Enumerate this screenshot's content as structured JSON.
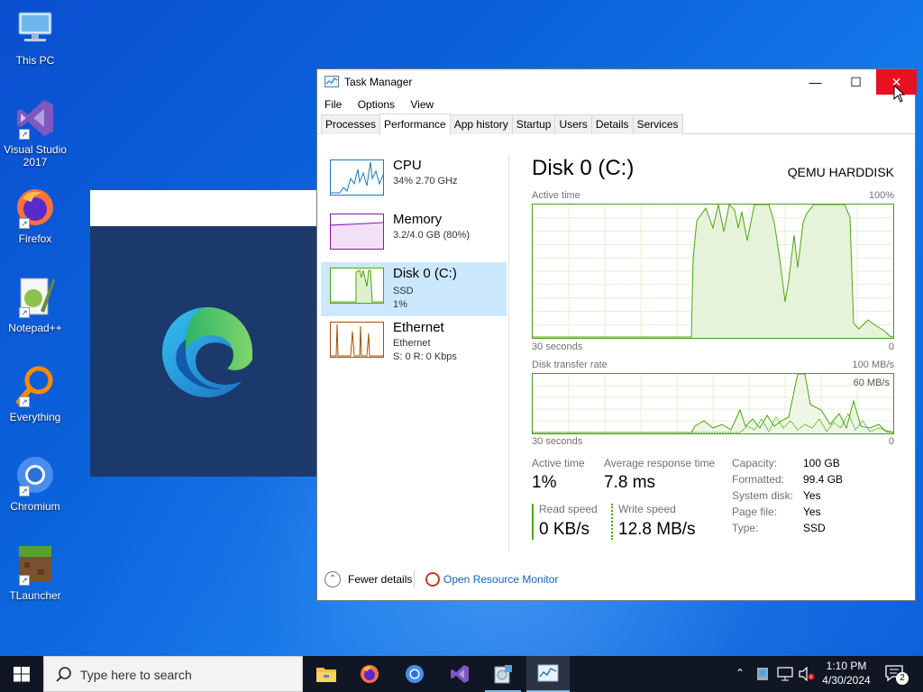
{
  "desktop": {
    "icons": [
      {
        "label": "This PC",
        "icon": "this-pc-icon"
      },
      {
        "label": "Visual Studio 2017",
        "icon": "visual-studio-icon"
      },
      {
        "label": "Firefox",
        "icon": "firefox-icon"
      },
      {
        "label": "Notepad++",
        "icon": "notepadpp-icon"
      },
      {
        "label": "Everything",
        "icon": "everything-icon"
      },
      {
        "label": "Chromium",
        "icon": "chromium-icon"
      },
      {
        "label": "TLauncher",
        "icon": "tlauncher-icon"
      }
    ]
  },
  "task_manager": {
    "title": "Task Manager",
    "menu": [
      "File",
      "Options",
      "View"
    ],
    "tabs": [
      "Processes",
      "Performance",
      "App history",
      "Startup",
      "Users",
      "Details",
      "Services"
    ],
    "active_tab": "Performance",
    "sidebar": [
      {
        "name": "CPU",
        "line1": "34%  2.70 GHz",
        "line2": "",
        "color": "#117dbb"
      },
      {
        "name": "Memory",
        "line1": "3.2/4.0 GB (80%)",
        "line2": "",
        "color": "#8b12ae"
      },
      {
        "name": "Disk 0 (C:)",
        "line1": "SSD",
        "line2": "1%",
        "color": "#4da60c"
      },
      {
        "name": "Ethernet",
        "line1": "Ethernet",
        "line2": "S: 0  R: 0 Kbps",
        "color": "#a74f01"
      }
    ],
    "selected": "Disk 0 (C:)",
    "detail": {
      "title": "Disk 0 (C:)",
      "model": "QEMU HARDDISK",
      "graph1": {
        "label": "Active time",
        "max": "100%",
        "time": "30 seconds",
        "min": "0",
        "values": [
          0,
          0,
          0,
          0,
          0,
          0,
          0,
          0,
          0,
          0,
          0,
          0,
          0,
          0,
          0,
          0,
          0,
          0,
          0,
          0,
          0,
          0,
          0,
          0,
          0,
          0,
          0,
          0,
          0,
          0,
          0,
          0,
          0,
          0,
          0,
          0,
          0,
          0,
          0,
          0,
          0,
          0,
          0,
          0,
          0,
          0,
          0,
          0,
          0,
          0,
          0,
          0,
          0,
          0,
          0,
          0,
          0,
          0,
          0,
          0,
          0,
          0,
          0,
          0,
          0,
          0,
          0,
          0,
          0,
          0,
          0,
          0,
          0,
          0,
          0,
          0,
          0,
          0,
          0,
          0,
          0,
          0,
          0,
          0,
          0,
          0,
          0,
          0,
          0,
          0,
          0,
          0,
          0,
          0,
          0,
          0,
          0,
          0,
          0,
          0,
          0,
          0,
          0,
          0,
          0,
          0,
          0,
          0,
          0,
          0,
          0,
          0,
          0,
          0,
          0,
          0,
          0,
          0,
          0,
          0,
          0,
          0,
          0,
          0,
          0,
          0,
          0,
          0,
          0,
          0,
          0,
          0,
          0,
          0,
          0,
          0,
          0,
          0,
          0,
          0,
          0,
          0,
          0,
          0,
          0,
          0,
          0,
          0,
          0,
          0,
          0,
          0,
          0,
          0,
          0,
          0,
          0,
          0,
          0,
          0,
          0,
          0,
          0,
          0,
          0,
          0,
          0,
          0,
          0,
          0,
          0,
          0,
          0,
          0,
          0,
          0,
          0,
          0,
          0,
          0,
          0,
          0,
          0,
          0,
          0,
          0,
          0,
          0,
          0,
          0,
          0,
          0,
          0,
          0,
          0,
          0,
          0,
          0,
          0,
          0,
          0,
          0,
          0,
          0,
          0,
          0,
          0,
          0,
          0,
          0,
          0,
          0,
          0,
          0,
          0,
          0,
          0,
          0,
          0,
          0,
          0,
          0,
          0,
          0,
          0,
          0,
          0,
          0,
          0,
          0,
          0,
          0,
          0,
          0,
          0,
          0,
          0,
          0,
          0,
          0,
          0,
          0,
          0,
          0,
          0,
          0,
          0,
          0,
          0,
          0,
          0,
          0,
          0,
          0,
          0,
          0,
          0,
          0,
          0,
          0,
          0,
          0,
          0,
          0,
          0,
          0,
          0,
          0,
          0,
          0,
          0,
          0,
          0,
          0,
          0,
          0,
          0,
          0,
          0,
          0,
          0,
          0,
          0,
          0,
          0,
          0,
          0,
          0,
          0,
          0,
          0,
          0,
          0,
          0,
          0,
          0,
          0,
          0,
          0,
          0,
          0,
          0,
          0,
          0,
          0,
          0,
          0,
          0,
          0,
          0,
          0,
          0,
          0,
          0,
          0,
          0,
          0,
          0,
          0,
          0,
          0,
          0,
          0,
          0,
          0,
          0,
          0,
          0,
          0,
          0,
          0,
          0,
          0,
          0,
          0,
          0,
          0,
          0,
          0,
          0,
          0,
          0,
          0,
          0,
          0,
          0,
          0,
          0,
          0,
          0,
          0,
          0,
          0,
          0,
          0,
          0,
          0,
          0,
          0,
          0,
          0,
          0,
          0,
          0,
          0,
          0,
          0,
          0,
          0,
          0,
          0,
          0,
          0,
          0,
          0,
          0,
          0,
          0,
          0,
          0,
          0,
          0,
          0,
          0,
          0,
          0,
          0,
          0,
          0,
          0,
          0,
          0,
          0,
          0,
          0,
          0,
          0,
          0,
          0,
          0,
          0
        ]
      },
      "graph2": {
        "label": "Disk transfer rate",
        "max": "100 MB/s",
        "scale": "60 MB/s",
        "time": "30 seconds",
        "min": "0"
      },
      "stats": {
        "active_time_label": "Active time",
        "active_time": "1%",
        "resp_label": "Average response time",
        "resp": "7.8 ms",
        "read_label": "Read speed",
        "read": "0 KB/s",
        "write_label": "Write speed",
        "write": "12.8 MB/s"
      },
      "props": [
        {
          "k": "Capacity:",
          "v": "100 GB"
        },
        {
          "k": "Formatted:",
          "v": "99.4 GB"
        },
        {
          "k": "System disk:",
          "v": "Yes"
        },
        {
          "k": "Page file:",
          "v": "Yes"
        },
        {
          "k": "Type:",
          "v": "SSD"
        }
      ]
    },
    "footer": {
      "fewer": "Fewer details",
      "monitor": "Open Resource Monitor"
    }
  },
  "taskbar": {
    "search_placeholder": "Type here to search",
    "apps": [
      "file-explorer-icon",
      "firefox-icon",
      "chromium-icon",
      "visual-studio-icon",
      "installer-icon",
      "task-manager-icon"
    ],
    "time": "1:10 PM",
    "date": "4/30/2024",
    "notification_count": "2"
  }
}
